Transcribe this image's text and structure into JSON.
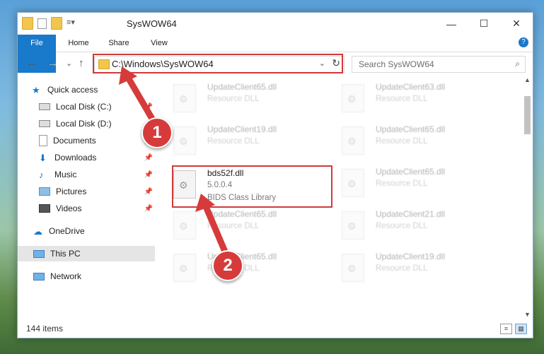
{
  "window": {
    "title": "SysWOW64",
    "controls": {
      "minimize": "—",
      "maximize": "☐",
      "close": "✕"
    }
  },
  "ribbon": {
    "tabs": [
      {
        "label": "File"
      },
      {
        "label": "Home"
      },
      {
        "label": "Share"
      },
      {
        "label": "View"
      }
    ],
    "help": "?"
  },
  "nav": {
    "back": "←",
    "forward": "→",
    "recent": "⌄",
    "up": "↑"
  },
  "address": {
    "path": "C:\\Windows\\SysWOW64",
    "refresh": "↻"
  },
  "search": {
    "placeholder": "Search SysWOW64"
  },
  "sidebar": {
    "items": [
      {
        "label": "Quick access",
        "icon": "star-icon"
      },
      {
        "label": "Local Disk (C:)",
        "icon": "drive-icon"
      },
      {
        "label": "Local Disk (D:)",
        "icon": "drive-icon"
      },
      {
        "label": "Documents",
        "icon": "documents-icon"
      },
      {
        "label": "Downloads",
        "icon": "download-icon"
      },
      {
        "label": "Music",
        "icon": "music-icon"
      },
      {
        "label": "Pictures",
        "icon": "pictures-icon"
      },
      {
        "label": "Videos",
        "icon": "videos-icon"
      },
      {
        "label": "OneDrive",
        "icon": "cloud-icon"
      },
      {
        "label": "This PC",
        "icon": "computer-icon"
      },
      {
        "label": "Network",
        "icon": "network-icon"
      }
    ]
  },
  "files": {
    "highlighted": {
      "name": "bds52f.dll",
      "version": "5.0.0.4",
      "description": "BIDS Class Library"
    },
    "left": [
      {
        "name": "UpdateClient65.dll",
        "type": "Resource DLL"
      },
      {
        "name": "UpdateClient19.dll",
        "type": "Resource DLL"
      },
      {
        "name": "UpdateClient65.dll",
        "type": "Resource DLL"
      },
      {
        "name": "UpdateClient65.dll",
        "type": "Resource DLL"
      }
    ],
    "right": [
      {
        "name": "UpdateClient63.dll",
        "type": "Resource DLL"
      },
      {
        "name": "UpdateClient65.dll",
        "type": "Resource DLL"
      },
      {
        "name": "UpdateClient65.dll",
        "type": "Resource DLL"
      },
      {
        "name": "UpdateClient21.dll",
        "type": "Resource DLL"
      },
      {
        "name": "UpdateClient19.dll",
        "type": "Resource DLL"
      }
    ]
  },
  "status": {
    "count": "144 items"
  },
  "annotations": {
    "step1": "1",
    "step2": "2"
  },
  "colors": {
    "accent": "#1979ca",
    "highlight": "#d03a3a",
    "marker": "#d63b3b"
  }
}
